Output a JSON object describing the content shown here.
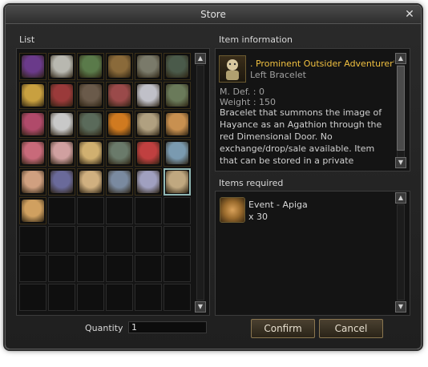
{
  "window": {
    "title": "Store",
    "close_glyph": "✕"
  },
  "list": {
    "label": "List",
    "items": [
      {
        "name": "item-1",
        "color": "#6a3a8a"
      },
      {
        "name": "item-2",
        "color": "#b8b8b0"
      },
      {
        "name": "item-3",
        "color": "#5a7a4a"
      },
      {
        "name": "item-4",
        "color": "#8a6a3a"
      },
      {
        "name": "item-5",
        "color": "#7a7a6a"
      },
      {
        "name": "item-6",
        "color": "#4a5a4a"
      },
      {
        "name": "item-7",
        "color": "#c8a040"
      },
      {
        "name": "item-8",
        "color": "#9a3a3a"
      },
      {
        "name": "item-9",
        "color": "#6a5a4a"
      },
      {
        "name": "item-10",
        "color": "#9a4a4a"
      },
      {
        "name": "item-11",
        "color": "#c0c0c8"
      },
      {
        "name": "item-12",
        "color": "#6a7a5a"
      },
      {
        "name": "item-13",
        "color": "#b04a6a"
      },
      {
        "name": "item-14",
        "color": "#c8c8c8"
      },
      {
        "name": "item-15",
        "color": "#5a6a5a"
      },
      {
        "name": "item-16",
        "color": "#d07a20"
      },
      {
        "name": "item-17",
        "color": "#b0a080"
      },
      {
        "name": "item-18",
        "color": "#c89050"
      },
      {
        "name": "item-19",
        "color": "#c86a7a"
      },
      {
        "name": "item-20",
        "color": "#d0a0a0"
      },
      {
        "name": "item-21",
        "color": "#d0b070"
      },
      {
        "name": "item-22",
        "color": "#6a7a6a"
      },
      {
        "name": "item-23",
        "color": "#c04040"
      },
      {
        "name": "item-24",
        "color": "#7a9ab0"
      },
      {
        "name": "item-25",
        "color": "#d0a080"
      },
      {
        "name": "item-26",
        "color": "#6a6a9a"
      },
      {
        "name": "item-27",
        "color": "#d0b080"
      },
      {
        "name": "item-28",
        "color": "#7a8aa0"
      },
      {
        "name": "item-29",
        "color": "#a0a0c0"
      },
      {
        "name": "item-30",
        "color": "#c0a880"
      },
      {
        "name": "item-31",
        "color": "#d0a060"
      }
    ],
    "selected_index": 29,
    "grid_rows": 9,
    "grid_cols": 6
  },
  "info": {
    "label": "Item information",
    "item_name": ". Prominent Outsider Adventurer's",
    "item_type": "Left Bracelet",
    "mdef": "M. Def. : 0",
    "weight": "Weight : 150",
    "description": "Bracelet that summons the image of Hayance as an Agathion through the red Dimensional Door. No exchange/drop/sale available. Item that can be stored in a private"
  },
  "required": {
    "label": "Items required",
    "item_name": "Event - Apiga",
    "count": "x 30"
  },
  "quantity": {
    "label": "Quantity",
    "value": "1"
  },
  "buttons": {
    "confirm": "Confirm",
    "cancel": "Cancel"
  },
  "icons": {
    "scroll_up": "▲",
    "scroll_down": "▼"
  }
}
